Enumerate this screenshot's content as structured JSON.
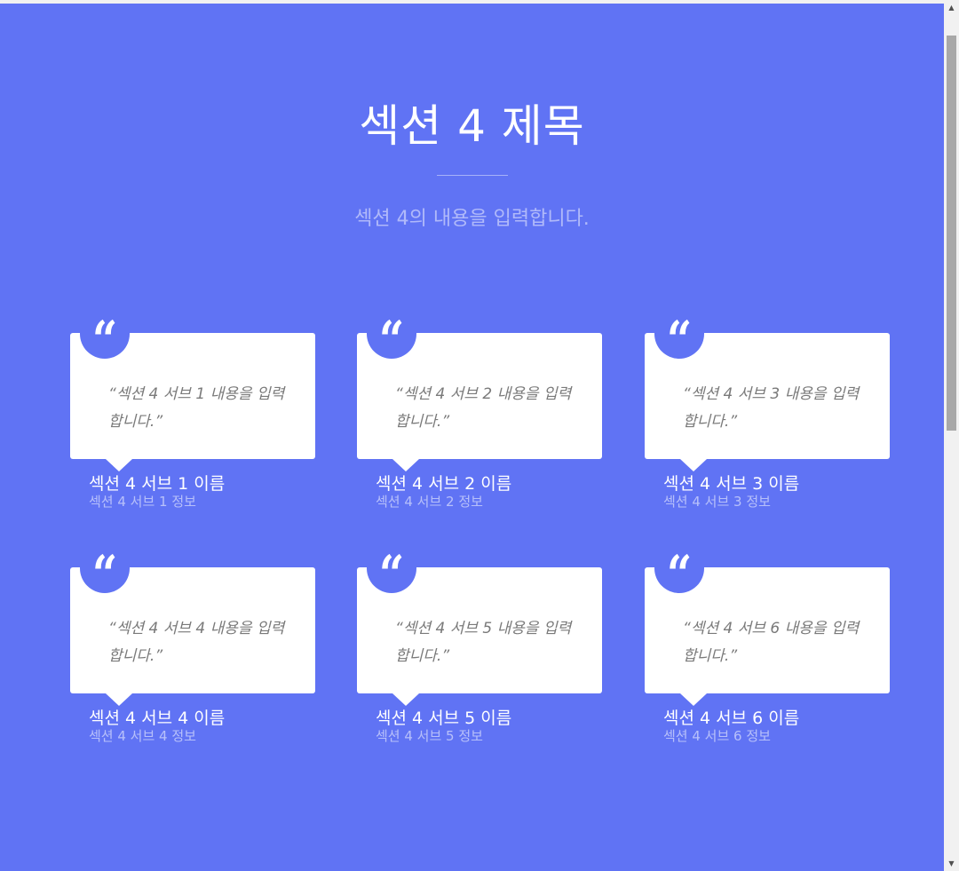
{
  "section": {
    "title": "섹션 4 제목",
    "description": "섹션 4의 내용을 입력합니다."
  },
  "quote_icon": "left-double-quote-icon",
  "colors": {
    "background": "#6073f4",
    "card": "#ffffff",
    "quote_text": "#7a7a7a"
  },
  "cards": [
    {
      "quote": "섹션 4 서브 1 내용을 입력합니다.",
      "name": "섹션 4 서브 1 이름",
      "info": "섹션 4 서브 1 정보"
    },
    {
      "quote": "섹션 4 서브 2 내용을 입력합니다.",
      "name": "섹션 4 서브 2 이름",
      "info": "섹션 4 서브 2 정보"
    },
    {
      "quote": "섹션 4 서브 3 내용을 입력합니다.",
      "name": "섹션 4 서브 3 이름",
      "info": "섹션 4 서브 3 정보"
    },
    {
      "quote": "섹션 4 서브 4 내용을 입력합니다.",
      "name": "섹션 4 서브 4 이름",
      "info": "섹션 4 서브 4 정보"
    },
    {
      "quote": "섹션 4 서브 5 내용을 입력합니다.",
      "name": "섹션 4 서브 5 이름",
      "info": "섹션 4 서브 5 정보"
    },
    {
      "quote": "섹션 4 서브 6 내용을 입력합니다.",
      "name": "섹션 4 서브 6 이름",
      "info": "섹션 4 서브 6 정보"
    }
  ]
}
